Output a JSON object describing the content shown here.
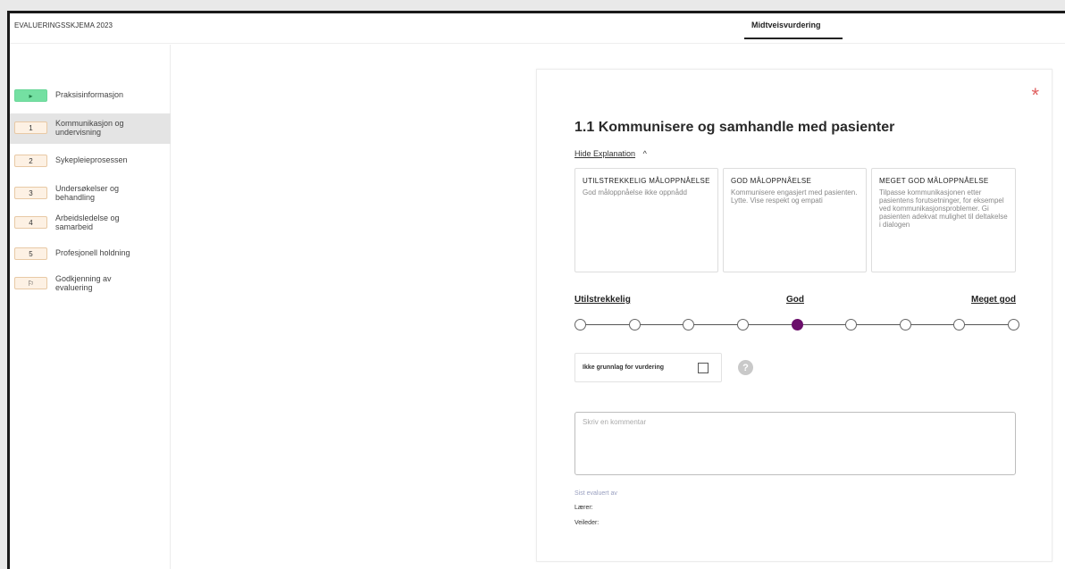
{
  "app": {
    "title": "EVALUERINGSSKJEMA 2023"
  },
  "tabs": {
    "active": "Midtveisvurdering"
  },
  "sidebar": {
    "items": [
      {
        "badge": "▸",
        "label": "Praksisinformasjon"
      },
      {
        "badge": "1",
        "label": "Kommunikasjon og undervisning"
      },
      {
        "badge": "2",
        "label": "Sykepleieprosessen"
      },
      {
        "badge": "3",
        "label": "Undersøkelser og behandling"
      },
      {
        "badge": "4",
        "label": "Arbeidsledelse og samarbeid"
      },
      {
        "badge": "5",
        "label": "Profesjonell holdning"
      },
      {
        "badge": "⚐",
        "label": "Godkjenning av evaluering"
      }
    ]
  },
  "main": {
    "asterisk": "*",
    "heading": "1.1 Kommunisere og samhandle med pasienter",
    "hide_explanation": "Hide Explanation",
    "chevron": "^",
    "explanations": [
      {
        "title": "UTILSTREKKELIG MÅLOPPNÅELSE",
        "text": "God måloppnåelse ikke oppnådd"
      },
      {
        "title": "GOD MÅLOPPNÅELSE",
        "text": "Kommunisere engasjert med pasienten. Lytte. Vise respekt og empati"
      },
      {
        "title": "MEGET GOD MÅLOPPNÅELSE",
        "text": "Tilpasse kommunikasjonen etter pasientens forutsetninger, for eksempel ved kommunikasjonsproblemer. Gi pasienten adekvat mulighet til deltakelse i dialogen"
      }
    ],
    "scale": {
      "low": "Utilstrekkelig",
      "mid": "God",
      "high": "Meget god",
      "steps": 9,
      "selected_index": 4
    },
    "no_basis_label": "Ikke grunnlag for vurdering",
    "help_glyph": "?",
    "comment_placeholder": "Skriv en kommentar",
    "evaluated_by": "Sist evaluert av",
    "student_label": "Lærer:",
    "supervisor_label": "Veileder:"
  },
  "colors": {
    "selected_dot": "#6b0f6b",
    "asterisk": "#e06060",
    "start_badge": "#74e0a2"
  }
}
